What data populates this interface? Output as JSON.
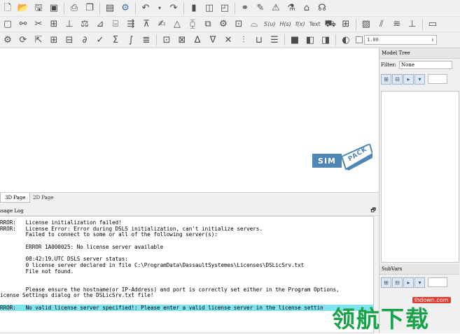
{
  "toolbar": {
    "row1_icons": [
      "new-file-icon",
      "open-folder-icon",
      "save-icon",
      "save-as-icon",
      "print-icon",
      "copy-icon",
      "clipboard-icon",
      "scale-icon",
      "settings-icon",
      "undo-icon",
      "undo-dropdown-icon",
      "redo-icon",
      "body-icon",
      "frame-icon",
      "marker-icon",
      "joint-icon",
      "force-icon",
      "constraint-icon",
      "sensor-icon",
      "expression-icon",
      "text-icon",
      "sweep-icon"
    ],
    "row2_labels": [
      "S(u)",
      "H(s)",
      "f(x)",
      "Text"
    ],
    "zoom_value": "1.00"
  },
  "view_tabs": {
    "tab_3d": "3D Page",
    "tab_2d": "2D Page"
  },
  "logo": {
    "sim": "SIM",
    "pack": "PACK"
  },
  "message_log": {
    "title": "essage Log",
    "lines": [
      "RROR:   License initialization failed!",
      "RROR:   License Error: Error during DSLS initialization, can't initialize servers.",
      "        Failed to connect to some or all of the following server(s):",
      "",
      "        ERROR 1A000025: No license server available",
      "",
      "        08:42:19.UTC DSLS server status:",
      "        0 license server declared in file C:\\ProgramData\\DassaultSystemes\\Licenses\\DSLicSrv.txt",
      "        File not found.",
      "",
      "",
      "        Please ensure the hostname(or IP-Address) and port is correctly set either in the Program Options,",
      "icense Settings dialog or the DSLicSrv.txt file!",
      "",
      "RROR:   No valid license server specified!: Please enter a valid license server in the license settin"
    ],
    "highlight_index": 14,
    "highlight_color": "#7fe4f0"
  },
  "model_tree": {
    "title": "Model Tree",
    "filter_label": "Filter:",
    "filter_value": "None"
  },
  "subvars": {
    "title": "SubVars"
  },
  "watermark": {
    "brand": "领航下载",
    "url": "lhdown.com"
  }
}
